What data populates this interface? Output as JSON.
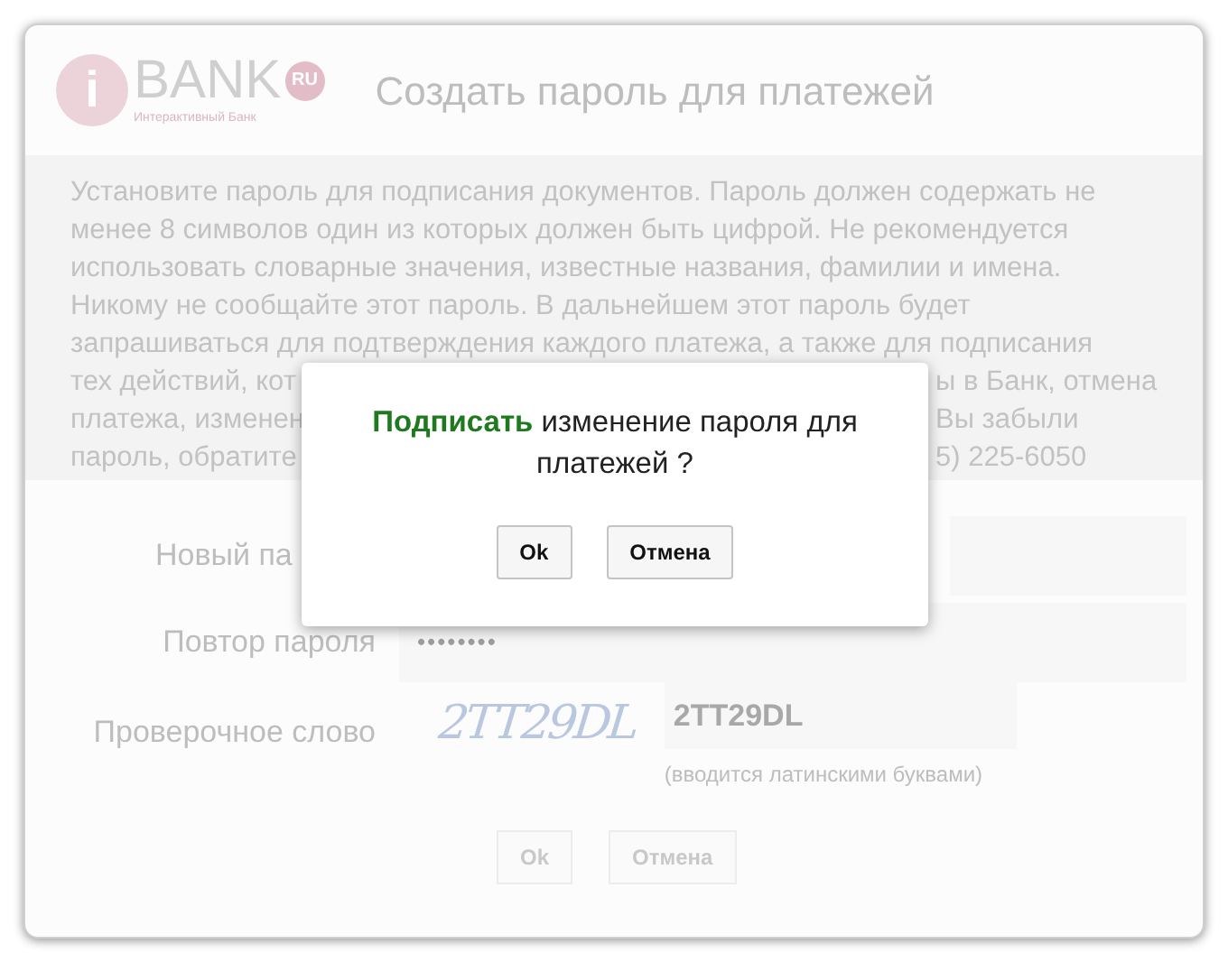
{
  "logo": {
    "word": "BANK",
    "badge": "RU",
    "tagline": "Интерактивный Банк",
    "letter": "i"
  },
  "title": "Создать пароль для платежей",
  "info_lines": [
    {
      "text": "Установите пароль для подписания документов. Пароль должен содержать не"
    },
    {
      "text": "менее 8 символов один из которых должен быть цифрой. Не рекомендуется"
    },
    {
      "text": "использовать словарные значения, известные названия, фамилии и имена."
    },
    {
      "text": "Никому не сообщайте этот пароль. В дальнейшем этот пароль будет"
    },
    {
      "text": "запрашиваться для подтверждения каждого платежа, а также для подписания"
    },
    {
      "left": "тех действий, кот",
      "right": "ы в Банк, отмена"
    },
    {
      "left": "платежа, изменен",
      "right": "Вы забыли"
    },
    {
      "left": "пароль, обратите",
      "right": "5) 225-6050"
    }
  ],
  "form": {
    "rows": [
      {
        "kind": "covered",
        "label": "Новый па"
      },
      {
        "kind": "password",
        "label": "Повтор пароля",
        "value": "••••••••"
      },
      {
        "kind": "captcha",
        "label": "Проверочное слово",
        "captcha": "2TT29DL",
        "value": "2TT29DL",
        "hint": "(вводится латинскими буквами)"
      }
    ],
    "buttons": [
      "Ok",
      "Отмена"
    ]
  },
  "dialog": {
    "message": "**Подписать** изменение пароля для платежей ?",
    "buttons": [
      "Ok",
      "Отмена"
    ]
  }
}
